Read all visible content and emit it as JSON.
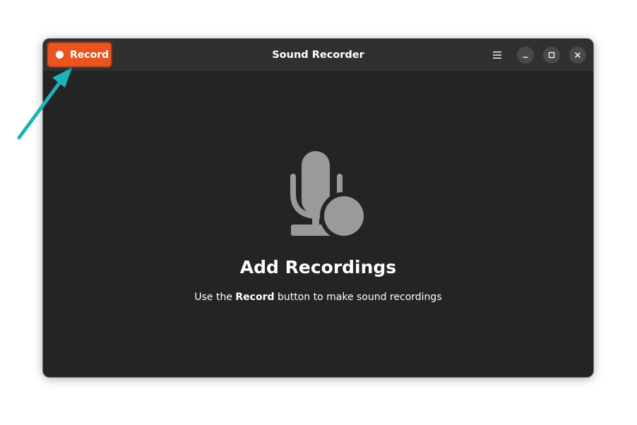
{
  "headerbar": {
    "record_label": "Record",
    "title": "Sound Recorder"
  },
  "empty_state": {
    "icon": "microphone-record-icon",
    "title": "Add Recordings",
    "description_prefix": "Use the ",
    "description_bold": "Record",
    "description_suffix": " button to make sound recordings"
  },
  "icons": {
    "menu": "hamburger-menu-icon",
    "minimize": "minimize-icon",
    "maximize": "maximize-icon",
    "close": "close-icon"
  },
  "colors": {
    "accent": "#e95420",
    "window_bg": "#242424",
    "headerbar_bg": "#303030",
    "annotation_arrow": "#1fb3b8"
  }
}
